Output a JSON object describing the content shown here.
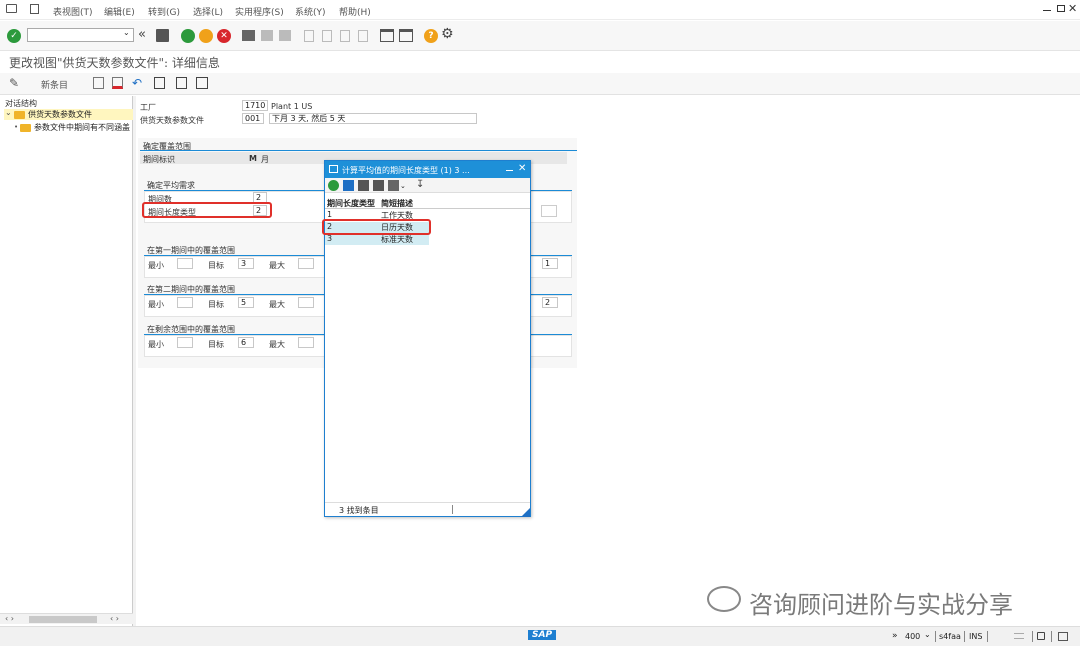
{
  "menu": {
    "items": [
      "表视图(T)",
      "编辑(E)",
      "转到(G)",
      "选择(L)",
      "实用程序(S)",
      "系统(Y)",
      "帮助(H)"
    ]
  },
  "title": "更改视图\"供货天数参数文件\": 详细信息",
  "toolbar2": {
    "new_entry": "新条目"
  },
  "left": {
    "header": "对话结构",
    "tree": [
      "供货天数参数文件",
      "参数文件中期间有不同涵盖"
    ]
  },
  "detail": {
    "plant_label": "工厂",
    "plant_code": "1710",
    "plant_name": "Plant 1 US",
    "profile_label": "供货天数参数文件",
    "profile_code": "001",
    "profile_desc": "下月 3 天, 然后 5 天",
    "coverage_title": "确定覆盖范围",
    "period_id_label": "期间标识",
    "period_id_code": "M",
    "period_id_text": "月",
    "avg_title": "确定平均需求",
    "num_periods_label": "期间数",
    "num_periods_value": "2",
    "period_len_label": "期间长度类型",
    "period_len_value": "2",
    "first_title": "在第一期间中的覆盖范围",
    "second_title": "在第二期间中的覆盖范围",
    "rest_title": "在剩余范围中的覆盖范围",
    "min_label": "最小",
    "target_label": "目标",
    "max_label": "最大",
    "first_target": "3",
    "second_target": "5",
    "rest_target": "6",
    "first_right": "1",
    "second_right": "2"
  },
  "popup": {
    "title": "计算平均值的期间长度类型 (1)   3 ...",
    "col1": "期间长度类型",
    "col2": "简短描述",
    "rows": [
      {
        "k": "1",
        "v": "工作天数"
      },
      {
        "k": "2",
        "v": "日历天数"
      },
      {
        "k": "3",
        "v": "标准天数"
      }
    ],
    "footer": "3 找到条目"
  },
  "status": {
    "sap_logo": "SAP",
    "client": "400",
    "system": "s4faa",
    "mode": "INS"
  },
  "watermark": "咨询顾问进阶与实战分享",
  "colors": {
    "accent": "#1e90d8",
    "highlight_row": "#d2ecf3",
    "tree_selected": "#fff6bf",
    "red_box": "#e0302a"
  }
}
